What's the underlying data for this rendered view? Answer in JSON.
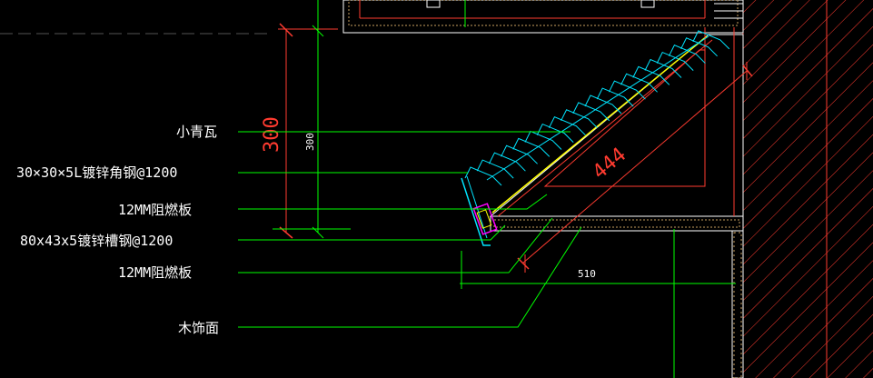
{
  "labels": {
    "tile": "小青瓦",
    "angle_steel": "30×30×5L镀锌角钢@1200",
    "board1": "12MM阻燃板",
    "channel_steel": "80x43x5镀锌槽钢@1200",
    "board2": "12MM阻燃板",
    "wood_finish": "木饰面"
  },
  "dimensions": {
    "height_red": "300",
    "height_white": "300",
    "diagonal": "444",
    "width": "510"
  },
  "colors": {
    "background": "#000000",
    "leader": "#00ff00",
    "dimension": "#ff3b30",
    "tile": "#00e5ff",
    "frame": "#ffffff",
    "wall_hatch": "#ff3b30",
    "accent_yellow": "#ffff00",
    "accent_magenta": "#ff00ff"
  }
}
